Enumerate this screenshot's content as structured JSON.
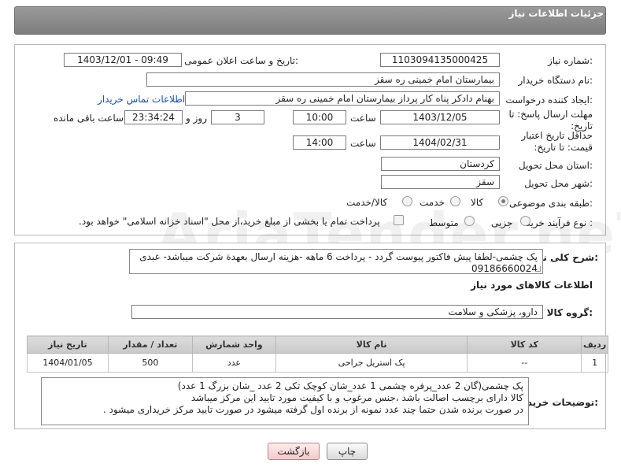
{
  "header": {
    "title": "جزئیات اطلاعات نیاز"
  },
  "form": {
    "need_number": {
      "label": "شماره نیاز:",
      "value": "1103094135000425"
    },
    "announce_date": {
      "label": "تاریخ و ساعت اعلان عمومی:",
      "value": "1403/12/01 - 09:49"
    },
    "buyer_org": {
      "label": "نام دستگاه خریدار:",
      "value": "بیمارستان امام خمینی  ره  سقز"
    },
    "requester": {
      "label": "ایجاد کننده درخواست:",
      "value": "بهنام دادکر پناه کار پرداز بیمارستان امام خمینی  ره  سقز",
      "contact_link": "اطلاعات تماس خریدار"
    },
    "reply_deadline": {
      "label": "مهلت ارسال پاسخ: تا تاریخ:",
      "date": "1403/12/05",
      "time_label": "ساعت",
      "time": "10:00",
      "days": "3",
      "days_label": "روز و",
      "remaining": "23:34:24",
      "remaining_label": "ساعت باقی مانده"
    },
    "price_validity": {
      "label": "حداقل تاریخ اعتبار قیمت: تا تاریخ:",
      "date": "1404/02/31",
      "time_label": "ساعت",
      "time": "14:00"
    },
    "province": {
      "label": "استان محل تحویل:",
      "value": "کردستان"
    },
    "city": {
      "label": "شهر محل تحویل:",
      "value": "سقز"
    },
    "category": {
      "label": "طبقه بندی موضوعی:",
      "options": [
        "کالا",
        "خدمت",
        "کالا/خدمت"
      ],
      "selected": "کالا"
    },
    "process": {
      "label": "نوع فرآیند خرید :",
      "options": [
        "جزیی",
        "متوسط"
      ],
      "note": "پرداخت تمام یا بخشی از مبلغ خرید،از محل \"اسناد خزانه اسلامی\" خواهد بود."
    }
  },
  "general_desc": {
    "label": "شرح کلی نیاز:",
    "value": "پک چشمی-لطفا پیش فاکتور پیوست گردد - پرداخت 6 ماهه -هزینه ارسال بعهدة شرکت میباشد- عبدی 09186660024"
  },
  "goods": {
    "section_title": "اطلاعات کالاهای مورد نیاز",
    "group_label": "گروه کالا:",
    "group_value": "دارو، پزشکی و سلامت",
    "columns": [
      "ردیف",
      "کد کالا",
      "نام کالا",
      "واحد شمارش",
      "تعداد / مقدار",
      "تاریخ نیاز"
    ],
    "rows": [
      {
        "row": "1",
        "code": "--",
        "name": "پک استریل جراحی",
        "unit": "عدد",
        "qty": "500",
        "date": "1404/01/05"
      }
    ]
  },
  "buyer_desc": {
    "label": "توضیحات خریدار:",
    "lines": [
      "پک چشمی(گان 2 عدد_پرفره چشمی 1 عدد_شان کوچک تکی 2 عدد _شان بزرگ 1 عدد)",
      "کالا دارای برچسب اصالت باشد ،جنس مرغوب و با کیفیت مورد تایید این مرکز میباشد",
      "در صورت برنده شدن حتما چند عدد نمونه از برنده اول گرفته میشود در صورت تایید مرکز خریداری میشود ."
    ]
  },
  "buttons": {
    "print": "چاپ",
    "back": "بازگشت"
  },
  "watermark": "AriaTender.neT"
}
